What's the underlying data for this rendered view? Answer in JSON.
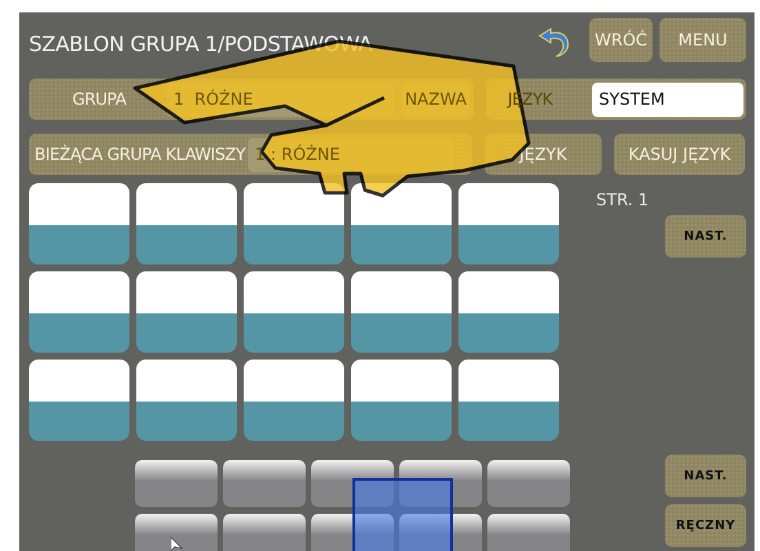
{
  "header": {
    "title": "SZABLON GRUPA 1/PODSTAWOWA",
    "buttons": [
      {
        "kind": "icon"
      },
      {
        "kind": "text",
        "label": "WRÓĆ"
      },
      {
        "kind": "text",
        "label": "MENU"
      }
    ]
  },
  "group_row": {
    "label": "GRUPA",
    "value": "1  RÓŻNE",
    "name_button": "NAZWA",
    "language_label": "JĘZYK",
    "language_value": "SYSTEM"
  },
  "current_row": {
    "label": "BIEŻĄCA GRUPA KLAWISZY",
    "value": "1 : RÓŻNE",
    "buttons": [
      "JĘZYK",
      "KASUJ JĘZYK"
    ]
  },
  "page_label": "STR. 1",
  "side_buttons": [
    {
      "label": "NAST."
    },
    {
      "label": "NAST."
    },
    {
      "label": "RĘCZNY"
    }
  ]
}
